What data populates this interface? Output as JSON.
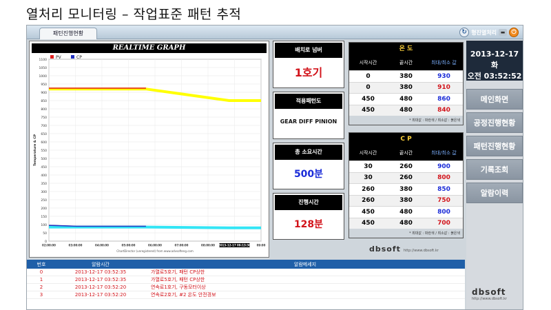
{
  "slide_title": "열처리 모니터링 – 작업표준 패턴 추적",
  "topbar": {
    "tab_label": "패턴진행현황",
    "brand": "형진열처리",
    "refresh_icon": "↻",
    "minimize_icon": "▬",
    "power_icon": "⏻"
  },
  "chart_data": {
    "type": "line",
    "title": "REALTIME GRAPH",
    "ylabel": "Temperature & CP",
    "ylim": [
      0,
      1100
    ],
    "y_ticks": [
      "0",
      "50",
      "100",
      "150",
      "200",
      "250",
      "300",
      "350",
      "400",
      "450",
      "500",
      "550",
      "600",
      "650",
      "700",
      "750",
      "800",
      "850",
      "900",
      "950",
      "1000",
      "1050",
      "1100"
    ],
    "x_ticks": [
      "02:00:00",
      "03:00:00",
      "04:00:00",
      "05:00:00",
      "06:00:00",
      "07:00:00",
      "08:00:00",
      "2013-12-17 09:13:30",
      "09:00"
    ],
    "x": [
      0,
      2,
      7,
      13,
      15.3
    ],
    "series": [
      {
        "name": "PV",
        "color": "#e02020",
        "values": [
          925,
          925,
          925,
          null,
          null
        ]
      },
      {
        "name": "CP",
        "color": "#2030c0",
        "values": [
          95,
          90,
          90,
          null,
          null
        ]
      },
      {
        "name": "",
        "color": "#ffff00",
        "values": [
          920,
          920,
          920,
          850,
          850
        ]
      },
      {
        "name": "",
        "color": "#33e5f5",
        "values": [
          85,
          85,
          85,
          80,
          80
        ]
      }
    ],
    "footer": "ChartDirector (unregistered) from www.advsofteng.com"
  },
  "info": {
    "furnace_label": "배치로 넘버",
    "furnace_value": "1호기",
    "pattern_label": "적용패턴도",
    "pattern_value": "GEAR DIFF PINION",
    "total_label": "총 소요시간",
    "total_value": "500분",
    "progress_label": "진행시간",
    "progress_value": "128분"
  },
  "temp_table": {
    "title": "온 도",
    "headers": [
      "시작시간",
      "끝시간",
      "최대/최소 값"
    ],
    "rows": [
      {
        "start": "0",
        "end": "380",
        "val": "930",
        "color": "#1a2bd8"
      },
      {
        "start": "0",
        "end": "380",
        "val": "910",
        "color": "#d2131a"
      },
      {
        "start": "450",
        "end": "480",
        "val": "860",
        "color": "#1a2bd8"
      },
      {
        "start": "450",
        "end": "480",
        "val": "840",
        "color": "#d2131a"
      }
    ],
    "note": "* 최대값 : 파란색 / 최소값 : 붉은색"
  },
  "cp_table": {
    "title": "C P",
    "headers": [
      "시작시간",
      "끝시간",
      "최대/최소 값"
    ],
    "rows": [
      {
        "start": "30",
        "end": "260",
        "val": "900",
        "color": "#1a2bd8"
      },
      {
        "start": "30",
        "end": "260",
        "val": "800",
        "color": "#d2131a"
      },
      {
        "start": "260",
        "end": "380",
        "val": "850",
        "color": "#1a2bd8"
      },
      {
        "start": "260",
        "end": "380",
        "val": "750",
        "color": "#d2131a"
      },
      {
        "start": "450",
        "end": "480",
        "val": "800",
        "color": "#1a2bd8"
      },
      {
        "start": "450",
        "end": "480",
        "val": "700",
        "color": "#d2131a"
      }
    ],
    "note": "* 최대값 : 파란색 / 최소값 : 붉은색"
  },
  "logo": {
    "text": "dbsoft",
    "url": "http://www.dbsoft.kr"
  },
  "sidebar": {
    "date": "2013-12-17 화",
    "time": "오전 03:52:52",
    "menu": [
      "메인화면",
      "공정진행현황",
      "패턴진행현황",
      "기록조회",
      "알람이력"
    ]
  },
  "alarm": {
    "headers": [
      "번호",
      "알람시간",
      "알람메세지"
    ],
    "rows": [
      {
        "no": "0",
        "time": "2013-12-17 03:52:35",
        "msg": "가열로5호기,   패턴 CP상한"
      },
      {
        "no": "1",
        "time": "2013-12-17 03:52:35",
        "msg": "가열로5호기,   패턴 CP상한"
      },
      {
        "no": "2",
        "time": "2013-12-17 03:52:20",
        "msg": "연속로1호기,   구동모터이상"
      },
      {
        "no": "3",
        "time": "2013-12-17 03:52:20",
        "msg": "연속로2호기,   #2 온도 안전경보"
      }
    ]
  }
}
